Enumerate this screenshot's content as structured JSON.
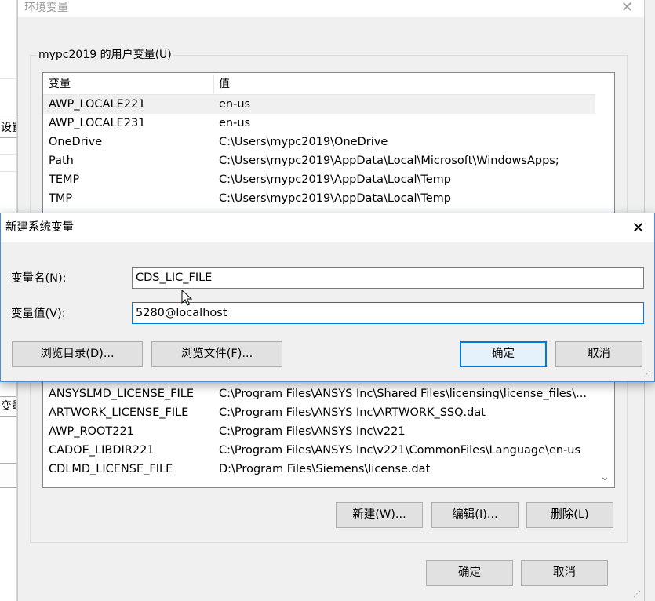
{
  "background_app": {
    "fragments": [
      "设置",
      "变量"
    ]
  },
  "env_window": {
    "title": "环境变量",
    "user_group": {
      "title": "mypc2019 的用户变量(U)",
      "columns": [
        "变量",
        "值"
      ],
      "rows": [
        {
          "name": "AWP_LOCALE221",
          "value": "en-us"
        },
        {
          "name": "AWP_LOCALE231",
          "value": "en-us"
        },
        {
          "name": "OneDrive",
          "value": "C:\\Users\\mypc2019\\OneDrive"
        },
        {
          "name": "Path",
          "value": "C:\\Users\\mypc2019\\AppData\\Local\\Microsoft\\WindowsApps;"
        },
        {
          "name": "TEMP",
          "value": "C:\\Users\\mypc2019\\AppData\\Local\\Temp"
        },
        {
          "name": "TMP",
          "value": "C:\\Users\\mypc2019\\AppData\\Local\\Temp"
        }
      ]
    },
    "system_group": {
      "rows": [
        {
          "name": "ANSYSLMD_LICENSE_FILE",
          "value": "C:\\Program Files\\ANSYS Inc\\Shared Files\\licensing\\license_files\\..."
        },
        {
          "name": "ARTWORK_LICENSE_FILE",
          "value": "C:\\Program Files\\ANSYS Inc\\ARTWORK_SSQ.dat"
        },
        {
          "name": "AWP_ROOT221",
          "value": "C:\\Program Files\\ANSYS Inc\\v221"
        },
        {
          "name": "CADOE_LIBDIR221",
          "value": "C:\\Program Files\\ANSYS Inc\\v221\\CommonFiles\\Language\\en-us"
        },
        {
          "name": "CDLMD_LICENSE_FILE",
          "value": "D:\\Program Files\\Siemens\\license.dat"
        }
      ],
      "buttons": {
        "new": "新建(W)...",
        "edit": "编辑(I)...",
        "delete": "删除(L)"
      }
    },
    "footer": {
      "ok": "确定",
      "cancel": "取消"
    }
  },
  "new_var_dialog": {
    "title": "新建系统变量",
    "name_label": "变量名(N):",
    "name_value": "CDS_LIC_FILE",
    "value_label": "变量值(V):",
    "value_value": "5280@localhost",
    "browse_dir": "浏览目录(D)...",
    "browse_file": "浏览文件(F)...",
    "ok": "确定",
    "cancel": "取消"
  },
  "colors": {
    "accent": "#0078d7",
    "window_bg": "#f0f0f0"
  },
  "icons": [
    "close-icon",
    "scroll-down-arrow-icon",
    "resize-grip-icon",
    "mouse-cursor-icon"
  ]
}
